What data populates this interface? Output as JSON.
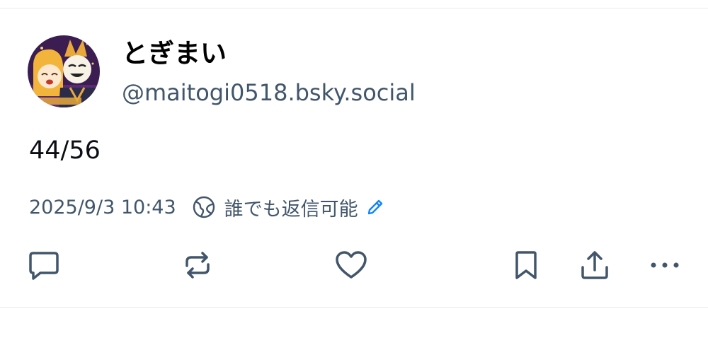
{
  "post": {
    "author": {
      "display_name": "とぎまい",
      "handle": "@maitogi0518.bsky.social",
      "avatar_icon": "avatar-image"
    },
    "text": "44/56",
    "timestamp": "2025/9/3 10:43",
    "reply_setting": {
      "icon": "globe-icon",
      "label": "誰でも返信可能",
      "edit_icon": "pencil-icon"
    }
  },
  "actions": [
    {
      "name": "reply",
      "icon": "speech-bubble-icon"
    },
    {
      "name": "repost",
      "icon": "repost-arrows-icon"
    },
    {
      "name": "like",
      "icon": "heart-icon"
    },
    {
      "name": "bookmark",
      "icon": "bookmark-icon"
    },
    {
      "name": "share",
      "icon": "share-icon"
    },
    {
      "name": "more",
      "icon": "ellipsis-icon"
    }
  ],
  "colors": {
    "text_primary": "#0b0f14",
    "text_secondary": "#42566b",
    "accent": "#1083fe",
    "divider": "#e6e9ed"
  }
}
